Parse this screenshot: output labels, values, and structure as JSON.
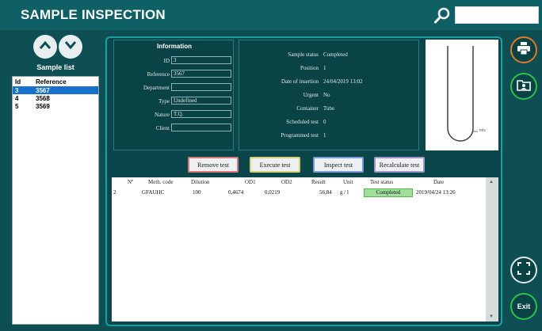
{
  "app": {
    "title": "SAMPLE INSPECTION"
  },
  "search": {
    "placeholder": "",
    "value": ""
  },
  "sidebar": {
    "label": "Sample list",
    "columns": [
      "Id",
      "Reference"
    ],
    "rows": [
      {
        "id": "3",
        "reference": "3567",
        "selected": true
      },
      {
        "id": "4",
        "reference": "3568",
        "selected": false
      },
      {
        "id": "5",
        "reference": "3569",
        "selected": false
      }
    ]
  },
  "information": {
    "title": "Information",
    "fields": [
      {
        "label": "ID",
        "value": "3"
      },
      {
        "label": "Reference",
        "value": "3567"
      },
      {
        "label": "Department",
        "value": ""
      },
      {
        "label": "Type",
        "value": "Undefined"
      },
      {
        "label": "Nature",
        "value": "T.Q."
      },
      {
        "label": "Client",
        "value": ""
      }
    ]
  },
  "status": {
    "fields": [
      {
        "label": "Sample status",
        "value": "Completed"
      },
      {
        "label": "Position",
        "value": "1"
      },
      {
        "label": "Date of insertion",
        "value": "24/04/2019  13:02"
      },
      {
        "label": "Urgent",
        "value": "No"
      },
      {
        "label": "Container",
        "value": "Tube"
      },
      {
        "label": "Scheduled test",
        "value": "0"
      },
      {
        "label": "Programmed test",
        "value": "1"
      }
    ]
  },
  "tube": {
    "unit_label": "mls"
  },
  "actions": {
    "remove": "Remove test",
    "execute": "Execute test",
    "inspect": "Inspect test",
    "recalculate": "Recalculate test"
  },
  "tests": {
    "headers": [
      "Nº",
      "Meth. code",
      "Dilution",
      "OD1",
      "OD2",
      "Result",
      "Unit",
      "Test status",
      "Date"
    ],
    "rows": [
      {
        "n": "2",
        "method": "GFAUHC",
        "dilution": "100",
        "od1": "0,4674",
        "od2": "0,0219",
        "result": "56,84",
        "unit": "g / l",
        "status": "Completed",
        "date": "2019/04/24  13:26"
      }
    ]
  },
  "right_buttons": {
    "exit": "Exit"
  },
  "icons": {
    "search": "search-icon",
    "up": "chevron-up-icon",
    "down": "chevron-down-icon",
    "print": "printer-icon",
    "folder": "folder-user-icon",
    "expand": "expand-icon"
  },
  "colors": {
    "background": "#0d4f52",
    "accent": "#17a1a6",
    "selected_row": "#1670cc",
    "status_completed": "#9ee09b",
    "print_ring": "#e07a2a",
    "green_ring": "#2fbf4f"
  }
}
